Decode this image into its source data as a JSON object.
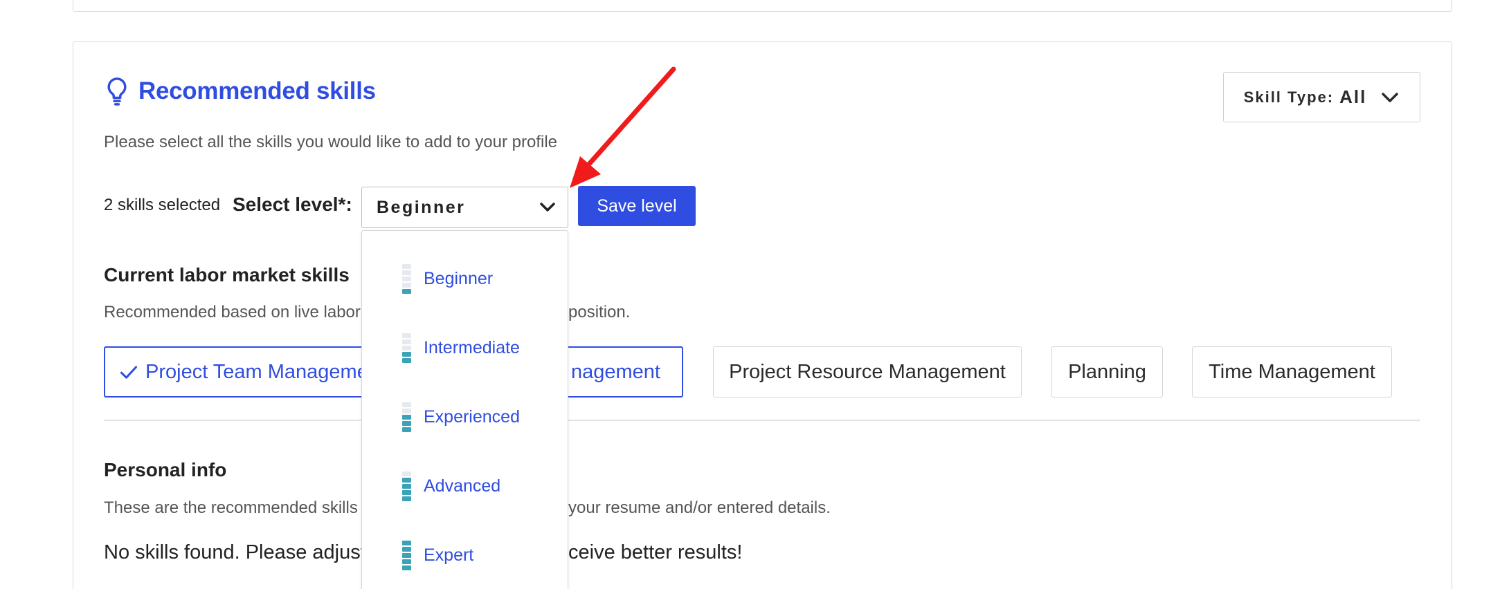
{
  "panel": {
    "title": "Recommended skills",
    "subtitle": "Please select all the skills you would like to add to your profile",
    "skill_type_label": "Skill Type:",
    "skill_type_value": "All"
  },
  "selection": {
    "count_text": "2 skills selected",
    "level_label": "Select level*:",
    "level_value": "Beginner",
    "save_label": "Save level"
  },
  "level_options": [
    {
      "label": "Beginner",
      "level": 1
    },
    {
      "label": "Intermediate",
      "level": 2
    },
    {
      "label": "Experienced",
      "level": 3
    },
    {
      "label": "Advanced",
      "level": 4
    },
    {
      "label": "Expert",
      "level": 5
    }
  ],
  "labor_market": {
    "title": "Current labor market skills",
    "desc_left": "Recommended based on live labor",
    "desc_right": "position.",
    "chips": [
      {
        "label_left": "Project Team Manageme",
        "label_right": "nagement",
        "selected": true
      },
      {
        "label": "Project Resource Management",
        "selected": false
      },
      {
        "label": "Planning",
        "selected": false
      },
      {
        "label": "Time Management",
        "selected": false
      }
    ]
  },
  "personal_info": {
    "title": "Personal info",
    "desc_left": "These are the recommended skills",
    "desc_right": "your resume and/or entered details.",
    "empty_left": "No skills found. Please adjust",
    "empty_right": "ceive better results!"
  },
  "colors": {
    "accent": "#2f4de0",
    "level_bar": "#3aa3b8",
    "arrow": "#f01c1c"
  },
  "icons": {
    "title_icon": "lightbulb-icon",
    "dropdown_icon": "chevron-down-icon"
  }
}
